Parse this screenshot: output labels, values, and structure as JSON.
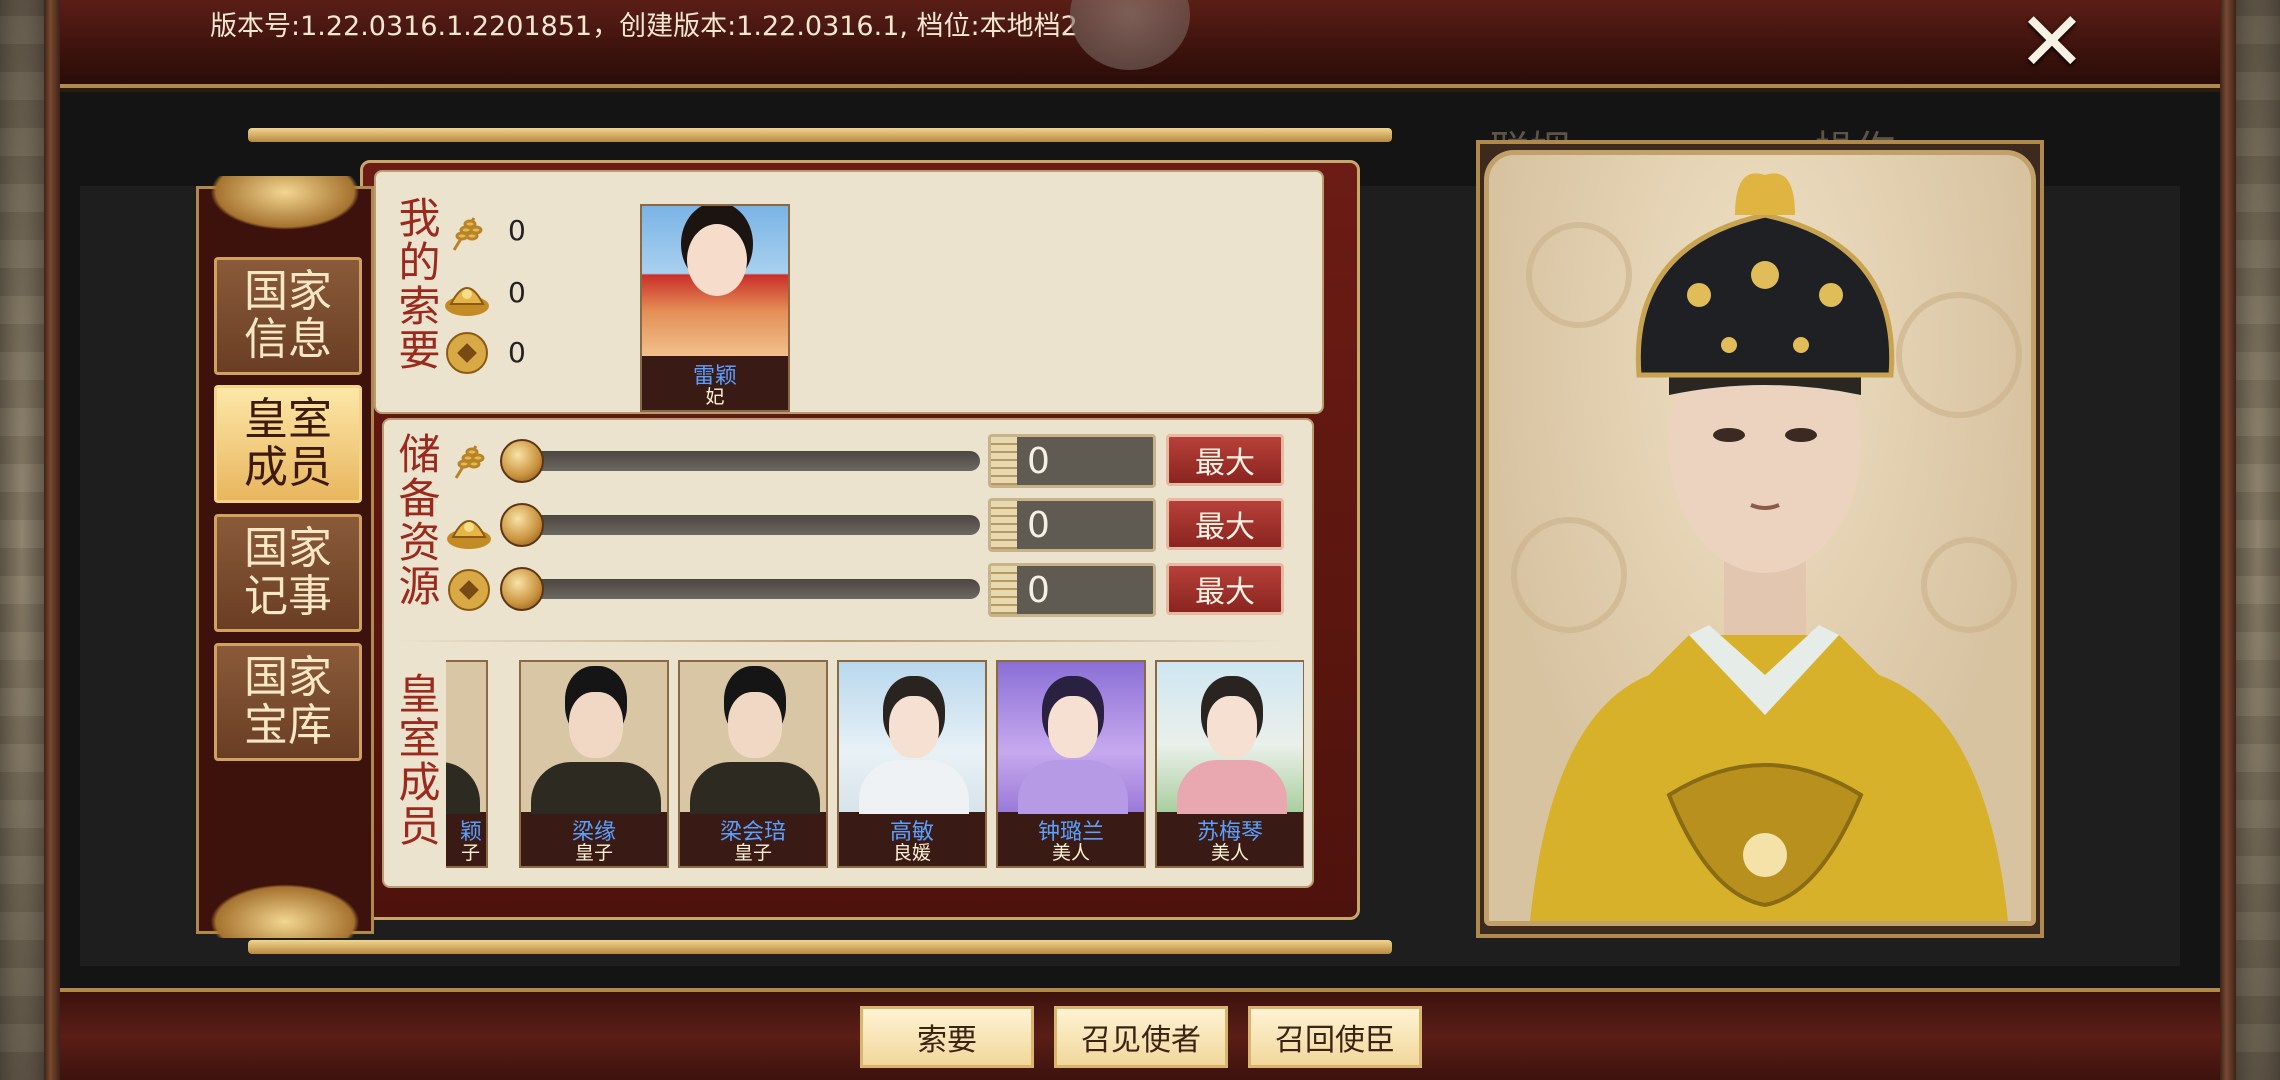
{
  "header": {
    "version_text": "版本号:1.22.0316.1.2201851，创建版本:1.22.0316.1, 档位:本地档2",
    "close_icon": "close-x-icon"
  },
  "background_tabs": {
    "left": "联姻",
    "right": "操作"
  },
  "sidebar": {
    "items": [
      {
        "label": "国家\n信息",
        "active": false
      },
      {
        "label": "皇室\n成员",
        "active": true
      },
      {
        "label": "国家\n记事",
        "active": false
      },
      {
        "label": "国家\n宝库",
        "active": false
      }
    ]
  },
  "my_request": {
    "label": "我的索要",
    "resources": [
      {
        "icon": "grain-icon",
        "value": "0"
      },
      {
        "icon": "gold-ingot-icon",
        "value": "0"
      },
      {
        "icon": "coin-icon",
        "value": "0"
      }
    ],
    "consort": {
      "name": "雷颖",
      "rank": "妃"
    }
  },
  "reserve": {
    "label": "储备资源",
    "rows": [
      {
        "icon": "grain-icon",
        "amount": "0",
        "max_label": "最大",
        "level": 0
      },
      {
        "icon": "gold-ingot-icon",
        "amount": "0",
        "max_label": "最大",
        "level": 0
      },
      {
        "icon": "coin-icon",
        "amount": "0",
        "max_label": "最大",
        "level": 0
      }
    ]
  },
  "royal_members": {
    "label": "皇室成员",
    "cards": [
      {
        "name": "颖",
        "rank": "子",
        "kind": "prince"
      },
      {
        "name": "梁缘",
        "rank": "皇子",
        "kind": "prince"
      },
      {
        "name": "梁会琣",
        "rank": "皇子",
        "kind": "prince"
      },
      {
        "name": "高敏",
        "rank": "良媛",
        "kind": "lady1"
      },
      {
        "name": "钟璐兰",
        "rank": "美人",
        "kind": "lady2"
      },
      {
        "name": "苏梅琴",
        "rank": "美人",
        "kind": "lady3"
      }
    ]
  },
  "bottom_buttons": {
    "request": "索要",
    "summon_envoy": "召见使者",
    "recall_envoy": "召回使臣"
  },
  "colors": {
    "frame_red": "#6c1c14",
    "gold": "#c9a66b",
    "parchment": "#ece3cf",
    "label_red": "#9c2a1c",
    "name_blue": "#5aa0ff",
    "max_button": "#b8403a"
  }
}
